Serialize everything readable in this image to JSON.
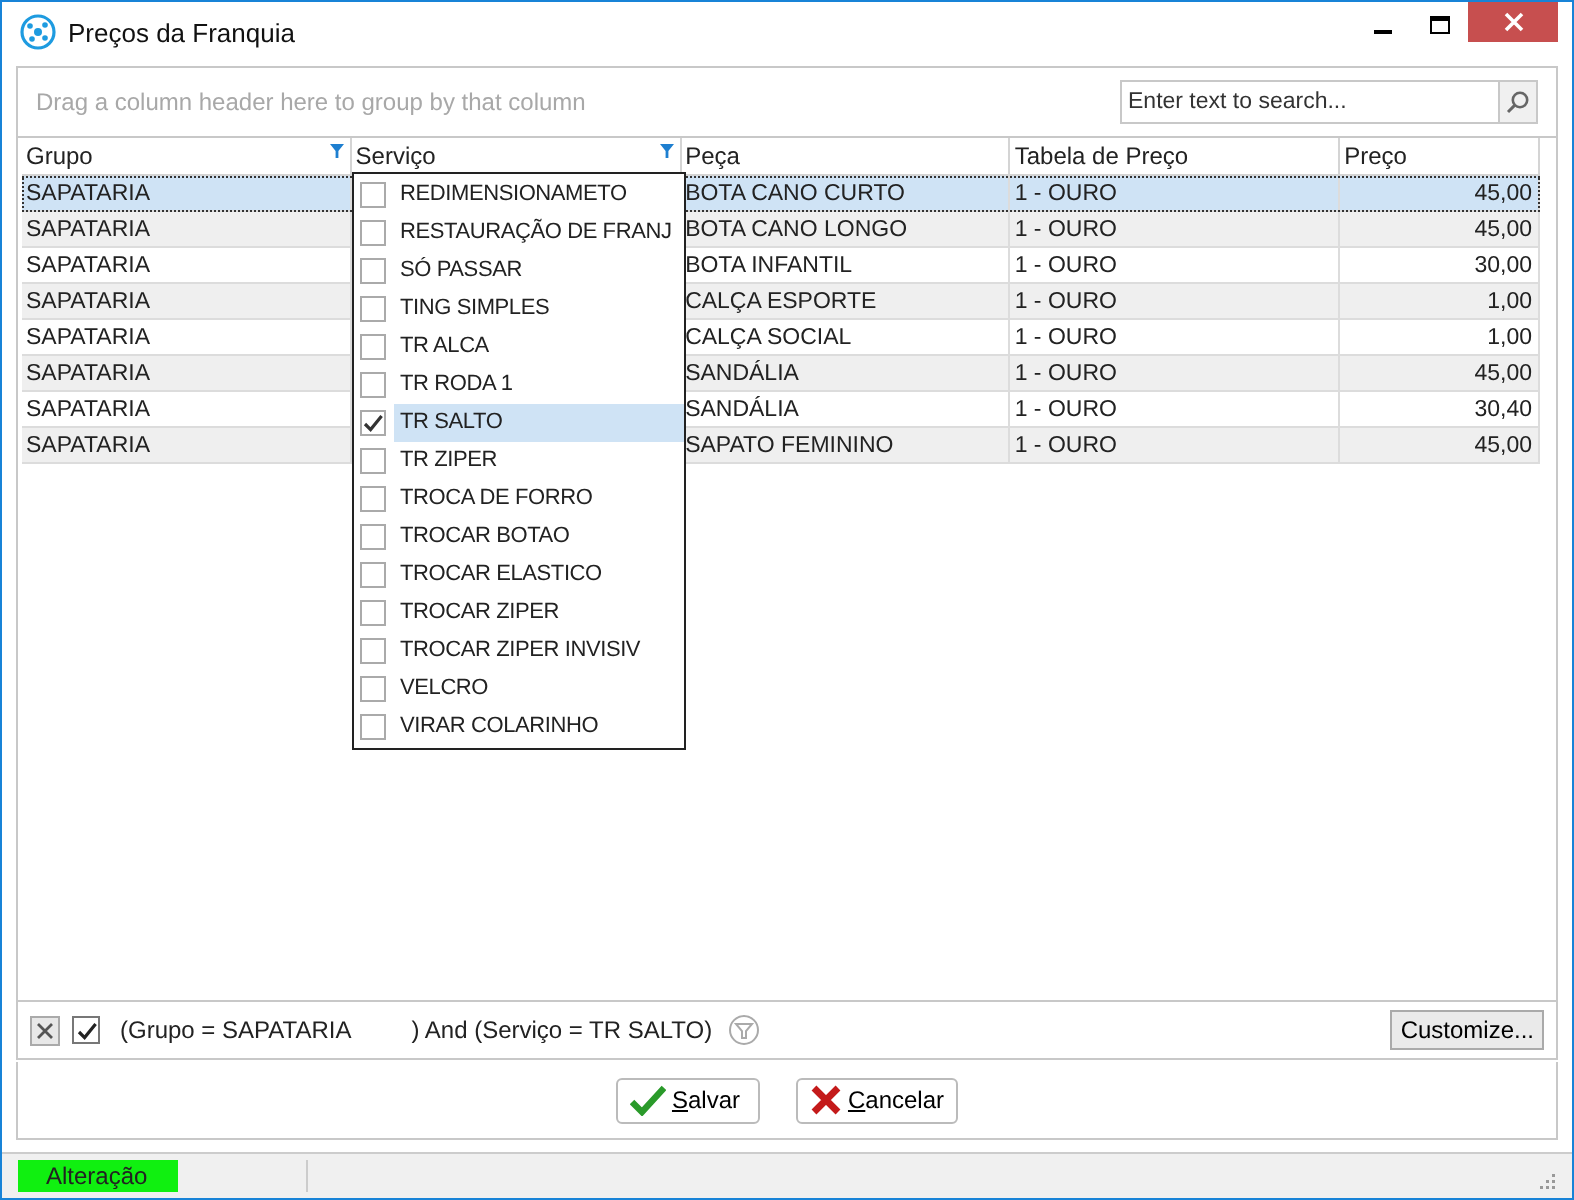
{
  "window": {
    "title": "Preços da Franquia"
  },
  "group_panel": {
    "hint": "Drag a column header here to group by that column",
    "search": {
      "placeholder": "Enter text to search..."
    }
  },
  "table": {
    "columns": [
      {
        "label": "Grupo",
        "filtered": true
      },
      {
        "label": "Serviço",
        "filtered": true
      },
      {
        "label": "Peça",
        "filtered": false
      },
      {
        "label": "Tabela de Preço",
        "filtered": false
      },
      {
        "label": "Preço",
        "filtered": false
      }
    ],
    "rows": [
      {
        "grupo": "SAPATARIA",
        "peca": "BOTA CANO CURTO",
        "tabela": "1 - OURO",
        "preco": "45,00",
        "selected": true
      },
      {
        "grupo": "SAPATARIA",
        "peca": "BOTA CANO LONGO",
        "tabela": "1 - OURO",
        "preco": "45,00",
        "selected": false
      },
      {
        "grupo": "SAPATARIA",
        "peca": "BOTA INFANTIL",
        "tabela": "1 - OURO",
        "preco": "30,00",
        "selected": false
      },
      {
        "grupo": "SAPATARIA",
        "peca": "CALÇA ESPORTE",
        "tabela": "1 - OURO",
        "preco": "1,00",
        "selected": false
      },
      {
        "grupo": "SAPATARIA",
        "peca": "CALÇA SOCIAL",
        "tabela": "1 - OURO",
        "preco": "1,00",
        "selected": false
      },
      {
        "grupo": "SAPATARIA",
        "peca": "SANDÁLIA",
        "tabela": "1 - OURO",
        "preco": "45,00",
        "selected": false
      },
      {
        "grupo": "SAPATARIA",
        "peca": "SANDÁLIA",
        "tabela": "1 - OURO",
        "preco": "30,40",
        "selected": false
      },
      {
        "grupo": "SAPATARIA",
        "peca": "SAPATO FEMININO",
        "tabela": "1 - OURO",
        "preco": "45,00",
        "selected": false
      }
    ]
  },
  "filter_dropdown": {
    "items": [
      {
        "label": "REDIMENSIONAMETO",
        "checked": false
      },
      {
        "label": "RESTAURAÇÃO DE FRANJ",
        "checked": false
      },
      {
        "label": "SÓ PASSAR",
        "checked": false
      },
      {
        "label": "TING SIMPLES",
        "checked": false
      },
      {
        "label": "TR ALCA",
        "checked": false
      },
      {
        "label": "TR RODA 1",
        "checked": false
      },
      {
        "label": "TR SALTO",
        "checked": true
      },
      {
        "label": "TR ZIPER",
        "checked": false
      },
      {
        "label": "TROCA DE FORRO",
        "checked": false
      },
      {
        "label": "TROCAR BOTAO",
        "checked": false
      },
      {
        "label": "TROCAR ELASTICO",
        "checked": false
      },
      {
        "label": "TROCAR ZIPER",
        "checked": false
      },
      {
        "label": "TROCAR ZIPER INVISIV",
        "checked": false
      },
      {
        "label": "VELCRO",
        "checked": false
      },
      {
        "label": "VIRAR COLARINHO",
        "checked": false
      }
    ]
  },
  "filter_bar": {
    "enabled": true,
    "expression_parts": [
      "(Grupo = SAPATARIA",
      ") And (Serviço = TR SALTO)"
    ],
    "customize_button": "Customize..."
  },
  "buttons": [
    {
      "kind": "save",
      "label": "Salvar"
    },
    {
      "kind": "cancel",
      "label": "Cancelar"
    }
  ],
  "status_bar": {
    "mode": "Alteração"
  }
}
